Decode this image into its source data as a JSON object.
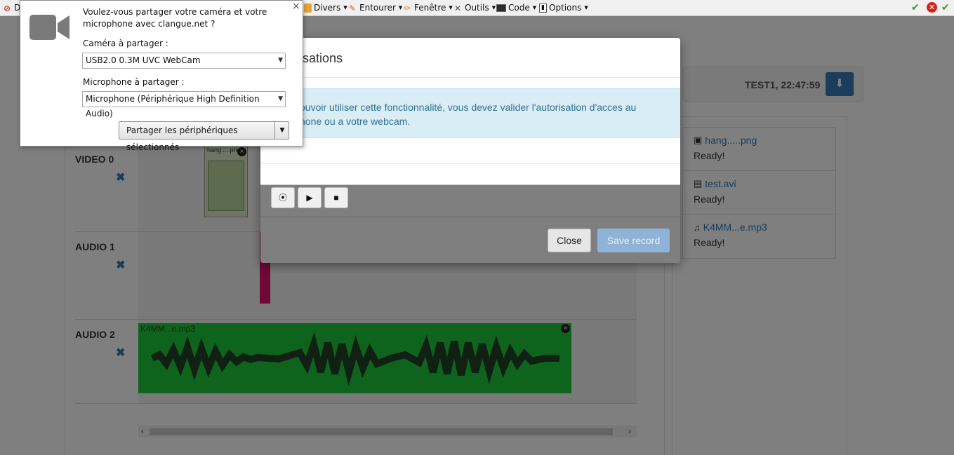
{
  "toolbar": {
    "items": [
      {
        "label": "D",
        "icon": "disable-icon"
      },
      {
        "label": "Divers",
        "icon": "notepad-icon"
      },
      {
        "label": "Entourer",
        "icon": "pencil-icon"
      },
      {
        "label": "Fenêtre",
        "icon": "ruler-pencil-icon"
      },
      {
        "label": "Outils",
        "icon": "tools-icon"
      },
      {
        "label": "Code",
        "icon": "terminal-icon"
      },
      {
        "label": "Options",
        "icon": "options-icon"
      }
    ],
    "right_icons": [
      "green-check-icon",
      "red-error-icon",
      "green-check-icon"
    ]
  },
  "permission_popup": {
    "question": "Voulez-vous partager votre caméra et votre microphone avec clangue.net ?",
    "camera_label": "Caméra à partager :",
    "camera_value": "USB2.0 0.3M UVC WebCam",
    "microphone_label": "Microphone à partager :",
    "microphone_value": "Microphone (Périphérique High Definition Audio)",
    "share_button": "Partager les périphériques sélectionnés",
    "close_glyph": "×"
  },
  "modal": {
    "title_visible": "sations",
    "alert_line1": "ouvoir utiliser cette fonctionnalité, vous devez valider l'autorisation d'acces au",
    "alert_line2": "hone ou a votre webcam.",
    "close_button": "Close",
    "save_button": "Save record"
  },
  "header": {
    "user_timestamp": "TEST1, 22:47:59"
  },
  "files": [
    {
      "name": "hang.....png",
      "status": "Ready!",
      "icon": "image-icon"
    },
    {
      "name": "test.avi",
      "status": "Ready!",
      "icon": "film-icon"
    },
    {
      "name": "K4MM...e.mp3",
      "status": "Ready!",
      "icon": "music-icon"
    }
  ],
  "tracks": [
    {
      "label": "VIDEO 0",
      "clip": "hang.....png"
    },
    {
      "label": "AUDIO 1",
      "clip": ""
    },
    {
      "label": "AUDIO 2",
      "clip": "K4MM...e.mp3"
    }
  ],
  "colors": {
    "primary": "#337ab7",
    "alert_bg": "#d9edf7",
    "audio_green": "#1dc93b",
    "audio_pink": "#e5106f"
  }
}
